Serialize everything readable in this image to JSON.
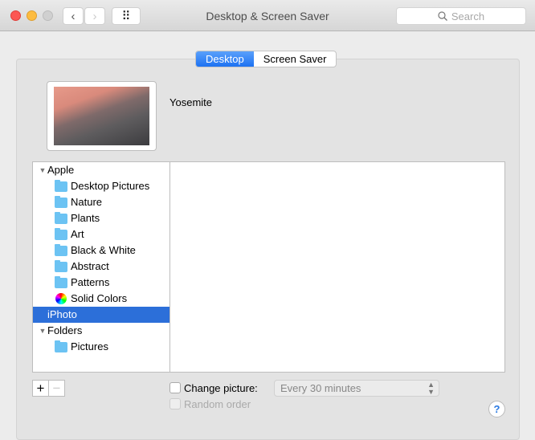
{
  "window": {
    "title": "Desktop & Screen Saver",
    "search_placeholder": "Search",
    "back": "‹",
    "forward": "›",
    "grid": "⠿"
  },
  "tabs": [
    {
      "label": "Desktop",
      "active": true
    },
    {
      "label": "Screen Saver",
      "active": false
    }
  ],
  "current_picture": "Yosemite",
  "sources": [
    {
      "label": "Apple",
      "type": "group"
    },
    {
      "label": "Desktop Pictures",
      "type": "folder"
    },
    {
      "label": "Nature",
      "type": "folder"
    },
    {
      "label": "Plants",
      "type": "folder"
    },
    {
      "label": "Art",
      "type": "folder"
    },
    {
      "label": "Black & White",
      "type": "folder"
    },
    {
      "label": "Abstract",
      "type": "folder"
    },
    {
      "label": "Patterns",
      "type": "folder"
    },
    {
      "label": "Solid Colors",
      "type": "colors"
    },
    {
      "label": "iPhoto",
      "type": "selected"
    },
    {
      "label": "Folders",
      "type": "group"
    },
    {
      "label": "Pictures",
      "type": "folder"
    }
  ],
  "controls": {
    "add": "+",
    "remove": "−",
    "change_picture_label": "Change picture:",
    "change_picture_checked": false,
    "interval": "Every 30 minutes",
    "random_order_label": "Random order",
    "help": "?"
  },
  "colors": {
    "accent": "#2c6fd9"
  }
}
